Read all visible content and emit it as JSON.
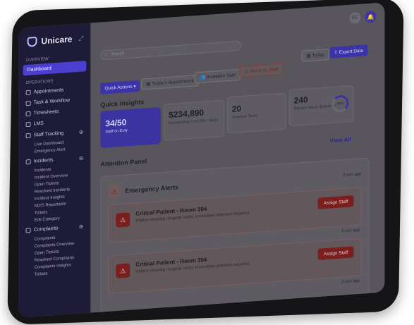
{
  "app": {
    "name": "Unicare"
  },
  "sidebar": {
    "overview_label": "OVERVIEW",
    "active_item": "Dashboard",
    "operations_label": "OPERATIONS",
    "items": [
      {
        "label": "Appointments"
      },
      {
        "label": "Task & Workflow"
      },
      {
        "label": "Timesheets"
      },
      {
        "label": "LMS"
      },
      {
        "label": "Staff Tracking"
      }
    ],
    "staff_sub": [
      "Live Dashboard",
      "Emergency Alert"
    ],
    "incidents_label": "Incidents",
    "incidents_sub": [
      "Incidents",
      "Incident Overview",
      "Open Tickets",
      "Resolved Incidents",
      "Incident Insights",
      "NDIS Reportable",
      "Tickets",
      "Edit Category"
    ],
    "complaints_label": "Complaints",
    "complaints_sub": [
      "Complaints",
      "Complaints Overview",
      "Open Tickets",
      "Resolved Complaints",
      "Complaints Insights",
      "Tickets"
    ]
  },
  "header": {
    "avatar": "EC",
    "search_placeholder": "Search",
    "today": "Today",
    "export": "Export Data"
  },
  "toolbar": {
    "quick_actions": "Quick Actions",
    "todays_appointment": "Today's Appointment",
    "available_staff": "Available Staff",
    "alerts_by_staff": "Alerts by Staff"
  },
  "insights": {
    "title": "Quick Insights",
    "cards": [
      {
        "value": "34/50",
        "label": "Staff on Duty"
      },
      {
        "value": "$234,890",
        "label": "Outstanding Cost (60+ days)"
      },
      {
        "value": "20",
        "label": "Overdue Tasks"
      },
      {
        "value": "240",
        "label": "Service Hours Delivered",
        "percent": "40%"
      }
    ]
  },
  "attention": {
    "title": "Attention Panel",
    "view_all": "View All",
    "alerts_title": "Emergency Alerts",
    "alerts_time": "2 min ago",
    "items": [
      {
        "title": "Critical Patient - Room 304",
        "desc": "Patient showing irregular vitals. Immediate attention required.",
        "action": "Assign Staff",
        "time": "2 min ago"
      },
      {
        "title": "Critical Patient - Room 304",
        "desc": "Patient showing irregular vitals. Immediate attention required.",
        "action": "Assign Staff",
        "time": "2 min ago"
      }
    ]
  }
}
